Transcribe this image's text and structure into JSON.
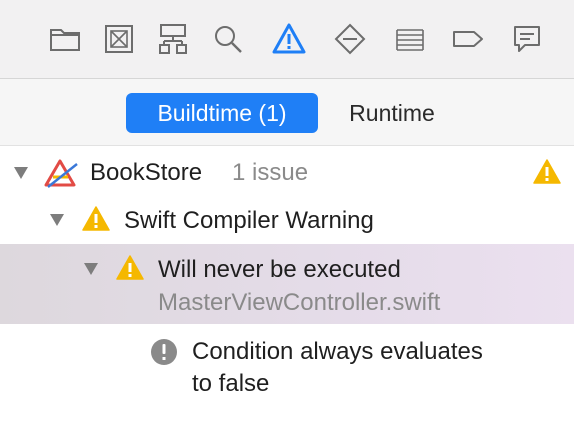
{
  "toolbar": {
    "icons": [
      "folder-icon",
      "symbol-navigator-icon",
      "hierarchy-icon",
      "search-icon",
      "warning-icon",
      "test-icon",
      "debug-icon",
      "breakpoint-icon",
      "report-icon"
    ],
    "selected": "warning-icon",
    "accent_color": "#1f7ff6"
  },
  "segment": {
    "buildtime_label": "Buildtime (1)",
    "runtime_label": "Runtime",
    "selected": "buildtime"
  },
  "tree": {
    "project": {
      "name": "BookStore",
      "count": "1 issue",
      "icon": "xcode-app-icon"
    },
    "group": {
      "label": "Swift Compiler Warning"
    },
    "issue": {
      "title": "Will never be executed",
      "file": "MasterViewController.swift"
    },
    "note": {
      "line1": "Condition always evaluates",
      "line2": "to false"
    }
  },
  "colors": {
    "warning": "#f5b800",
    "selected_row": "#e3dbe6"
  }
}
